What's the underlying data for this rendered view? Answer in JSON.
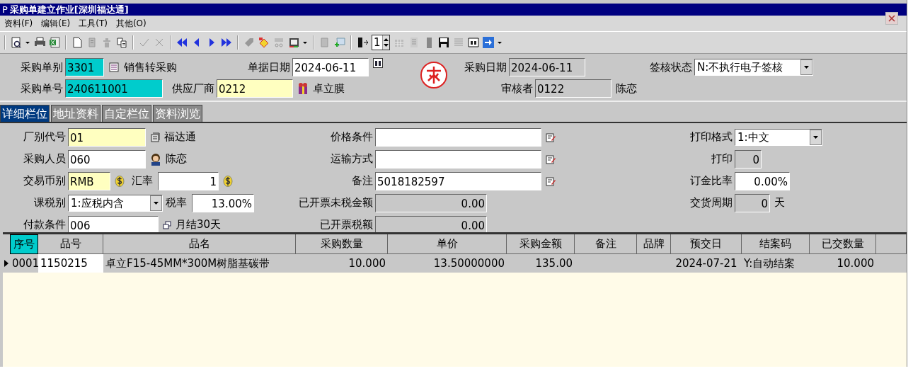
{
  "window": {
    "icon_letter": "P",
    "title": "采购单建立作业[深圳福达通]"
  },
  "menu": [
    {
      "label": "资料(F)"
    },
    {
      "label": "编辑(E)"
    },
    {
      "label": "工具(T)"
    },
    {
      "label": "其他(O)"
    }
  ],
  "toolbar": {
    "page_value": "1"
  },
  "header": {
    "order_type": {
      "label": "采购单别",
      "value": "3301",
      "note": "销售转采购"
    },
    "order_no": {
      "label": "采购单号",
      "value": "240611001"
    },
    "doc_date": {
      "label": "单据日期",
      "value": "2024-06-11"
    },
    "supplier": {
      "label": "供应厂商",
      "value": "0212",
      "note": "卓立膜"
    },
    "purchase_date": {
      "label": "采购日期",
      "value": "2024-06-11"
    },
    "reviewer": {
      "label": "审核者",
      "value": "0122",
      "note": "陈恋"
    },
    "sign_status": {
      "label": "签核状态",
      "value": "N:不执行电子签核"
    }
  },
  "tabs": [
    {
      "label": "详细栏位",
      "selected": true
    },
    {
      "label": "地址资料",
      "selected": false
    },
    {
      "label": "自定栏位",
      "selected": false
    },
    {
      "label": "资料浏览",
      "selected": false
    }
  ],
  "detail": {
    "factory": {
      "label": "厂别代号",
      "value": "01",
      "note": "福达通"
    },
    "buyer": {
      "label": "采购人员",
      "value": "060",
      "note": "陈恋"
    },
    "currency": {
      "label": "交易币别",
      "value": "RMB"
    },
    "rate": {
      "label": "汇率",
      "value": "1"
    },
    "tax_type": {
      "label": "课税别",
      "value": "1:应税内含"
    },
    "tax_rate": {
      "label": "税率",
      "value": "13.00%"
    },
    "payment": {
      "label": "付款条件",
      "value": "006",
      "note": "月结30天"
    },
    "price_terms": {
      "label": "价格条件"
    },
    "shipping": {
      "label": "运输方式"
    },
    "remark": {
      "label": "备注",
      "value": "5018182597"
    },
    "invoiced_net": {
      "label": "已开票未税金额",
      "value": "0.00"
    },
    "invoiced_tax": {
      "label": "已开票税额",
      "value": "0.00"
    },
    "print_format": {
      "label": "打印格式",
      "value": "1:中文"
    },
    "print": {
      "label": "打印",
      "value": "0"
    },
    "deposit": {
      "label": "订金比率",
      "value": "0.00%"
    },
    "lead_time": {
      "label": "交货周期",
      "value": "0",
      "unit": "天"
    }
  },
  "grid": {
    "columns": [
      {
        "label": "序号",
        "selected": true
      },
      {
        "label": "品号",
        "selected": false
      },
      {
        "label": "品名",
        "selected": false
      },
      {
        "label": "采购数量",
        "selected": false
      },
      {
        "label": "单价",
        "selected": false
      },
      {
        "label": "采购金额",
        "selected": false
      },
      {
        "label": "备注",
        "selected": false
      },
      {
        "label": "品牌",
        "selected": false
      },
      {
        "label": "预交日",
        "selected": false
      },
      {
        "label": "结案码",
        "selected": false
      },
      {
        "label": "已交数量",
        "selected": false
      }
    ],
    "rows": [
      {
        "current": true,
        "cells": [
          "0001",
          "1150215",
          "卓立F15-45MM*300M树脂基碳带",
          "10.000",
          "13.50000000",
          "135.00",
          "",
          "",
          "2024-07-21",
          "Y:自动结案",
          "10.000"
        ]
      }
    ]
  }
}
